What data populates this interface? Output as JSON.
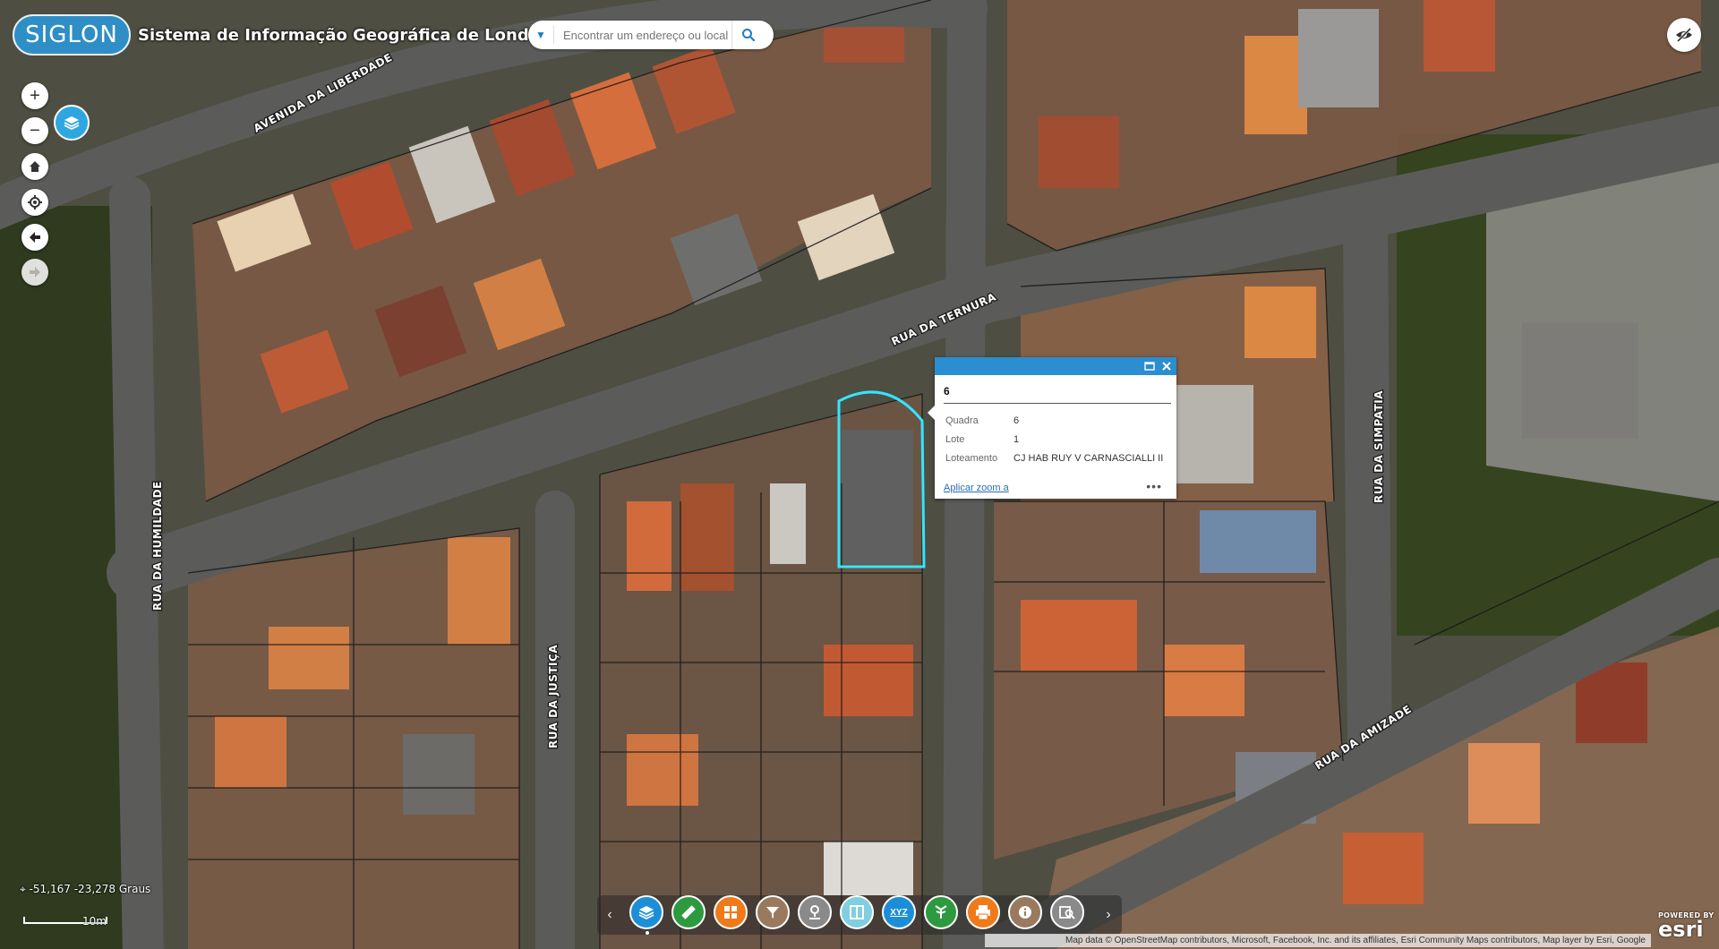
{
  "header": {
    "logo_text": "SIGLON",
    "title": "Sistema de Informação Geográfica de Londrina"
  },
  "search": {
    "placeholder": "Encontrar um endereço ou local"
  },
  "map": {
    "street_labels": [
      "AVENIDA DA LIBERDADE",
      "RUA DA TERNURA",
      "RUA DA HUMILDADE",
      "RUA DA JUSTIÇA",
      "RUA DA SIMPATIA",
      "RUA DA AMIZADE"
    ],
    "highlight_color": "#33e6ff"
  },
  "popup": {
    "title": "6",
    "fields": [
      {
        "label": "Quadra",
        "value": "6"
      },
      {
        "label": "Lote",
        "value": "1"
      },
      {
        "label": "Loteamento",
        "value": "CJ HAB RUY V CARNASCIALLI II"
      }
    ],
    "zoom_link": "Aplicar zoom a",
    "more": "•••",
    "header_color": "#2a8ed0"
  },
  "coordinates": "-51,167 -23,278 Graus",
  "scale_label": "10m",
  "toolbar": {
    "icons": [
      {
        "name": "layer-list",
        "color": "#1c8ed8"
      },
      {
        "name": "measure",
        "color": "#2d9a3f"
      },
      {
        "name": "basemap-gallery",
        "color": "#f07a1a"
      },
      {
        "name": "filter",
        "color": "#9a7a5f"
      },
      {
        "name": "directions",
        "color": "#8a8a8a"
      },
      {
        "name": "swipe",
        "color": "#7fcfe0"
      },
      {
        "name": "coordinate-xyz",
        "color": "#1c8ed8"
      },
      {
        "name": "share",
        "color": "#2d9a3f"
      },
      {
        "name": "print",
        "color": "#f07a1a"
      },
      {
        "name": "about",
        "color": "#9a7a5f"
      },
      {
        "name": "query",
        "color": "#8a8a8a"
      }
    ],
    "xyz_text": "XYZ"
  },
  "attribution": "Map data © OpenStreetMap contributors, Microsoft, Facebook, Inc. and its affiliates, Esri Community Maps contributors, Map layer by Esri, Google",
  "esri": {
    "powered": "POWERED BY",
    "brand": "esri"
  }
}
